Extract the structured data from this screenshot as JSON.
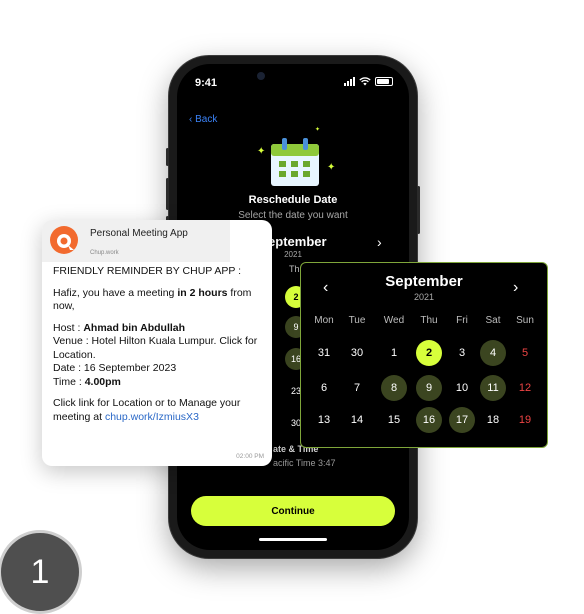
{
  "phone": {
    "status_time": "9:41",
    "back_label": "Back",
    "title": "Reschedule Date",
    "subtitle": "Select the date you want",
    "month": "September",
    "year": "2021",
    "next_arrow": "›",
    "visible_dow": [
      "d",
      "Th"
    ],
    "visible_days": [
      "2",
      "9",
      "16",
      "23",
      "30"
    ],
    "timezone_label": "ate & Time",
    "timezone_value": "acific Time 3:47",
    "continue_label": "Continue"
  },
  "notification": {
    "app_name": "Personal Meeting App",
    "domain": "Chup.work",
    "line1": "FRIENDLY REMINDER BY CHUP APP :",
    "greeting_prefix": "Hafiz, you have a meeting ",
    "greeting_bold": "in 2 hours",
    "greeting_suffix": " from now,",
    "host_label": "Host : ",
    "host_value": "Ahmad bin Abdullah",
    "venue": "Venue :  Hotel Hilton Kuala Lumpur. Click for Location.",
    "date": "Date : 16 September 2023",
    "time_label": "Time : ",
    "time_value": "4.00pm",
    "cta_text": "Click link for Location or to Manage your meeting at ",
    "link": "chup.work/IzmiusX3",
    "timestamp": "02:00 PM"
  },
  "overlay_calendar": {
    "month": "September",
    "year": "2021",
    "prev_arrow": "‹",
    "next_arrow": "›",
    "days_of_week": [
      "Mon",
      "Tue",
      "Wed",
      "Thu",
      "Fri",
      "Sat",
      "Sun"
    ],
    "weeks": [
      [
        "31",
        "30",
        "1",
        "2",
        "3",
        "4",
        "5"
      ],
      [
        "6",
        "7",
        "8",
        "9",
        "10",
        "11",
        "12"
      ],
      [
        "13",
        "14",
        "15",
        "16",
        "17",
        "18",
        "19"
      ]
    ],
    "selected_day": "2",
    "available_days": [
      "4",
      "8",
      "9",
      "11",
      "16",
      "17"
    ],
    "accent_color": "#d7ff3b",
    "available_color": "#3b4520",
    "sunday_color": "#ee4444"
  },
  "step_number": "1"
}
